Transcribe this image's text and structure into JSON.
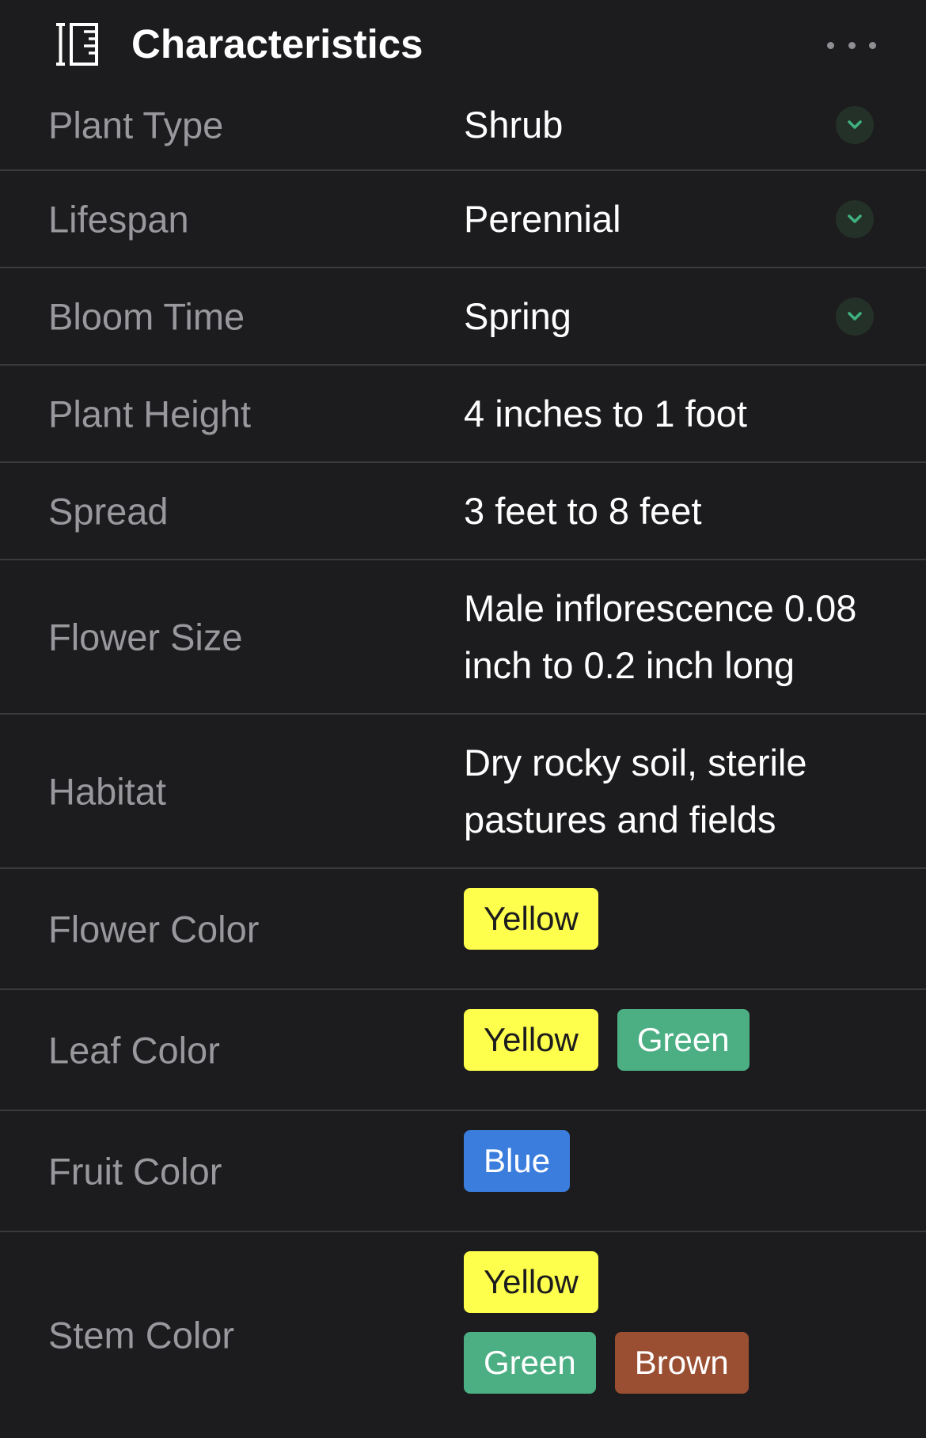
{
  "header": {
    "title": "Characteristics",
    "icon": "ruler-icon",
    "more_icon": "more-horizontal-icon"
  },
  "rows": [
    {
      "label": "Plant Type",
      "value": "Shrub",
      "has_dropdown": true
    },
    {
      "label": "Lifespan",
      "value": "Perennial",
      "has_dropdown": true
    },
    {
      "label": "Bloom Time",
      "value": "Spring",
      "has_dropdown": true
    },
    {
      "label": "Plant Height",
      "value": "4 inches to 1 foot"
    },
    {
      "label": "Spread",
      "value": "3 feet to 8 feet"
    },
    {
      "label": "Flower Size",
      "value": "Male inflorescence 0.08 inch to 0.2 inch long"
    },
    {
      "label": "Habitat",
      "value": "Dry rocky soil, sterile pastures and fields"
    },
    {
      "label": "Flower Color",
      "tags": [
        "Yellow"
      ]
    },
    {
      "label": "Leaf Color",
      "tags": [
        "Yellow",
        "Green"
      ]
    },
    {
      "label": "Fruit Color",
      "tags": [
        "Blue"
      ]
    },
    {
      "label": "Stem Color",
      "tags": [
        "Yellow",
        "Green",
        "Brown"
      ]
    }
  ],
  "colors": {
    "background": "#1c1c1e",
    "divider": "#3a3a3c",
    "label": "#98989d",
    "chevron_accent": "#3fb27f",
    "Yellow": "#fefe4c",
    "Green": "#4caf84",
    "Blue": "#3b7ddd",
    "Brown": "#9a4f33"
  }
}
